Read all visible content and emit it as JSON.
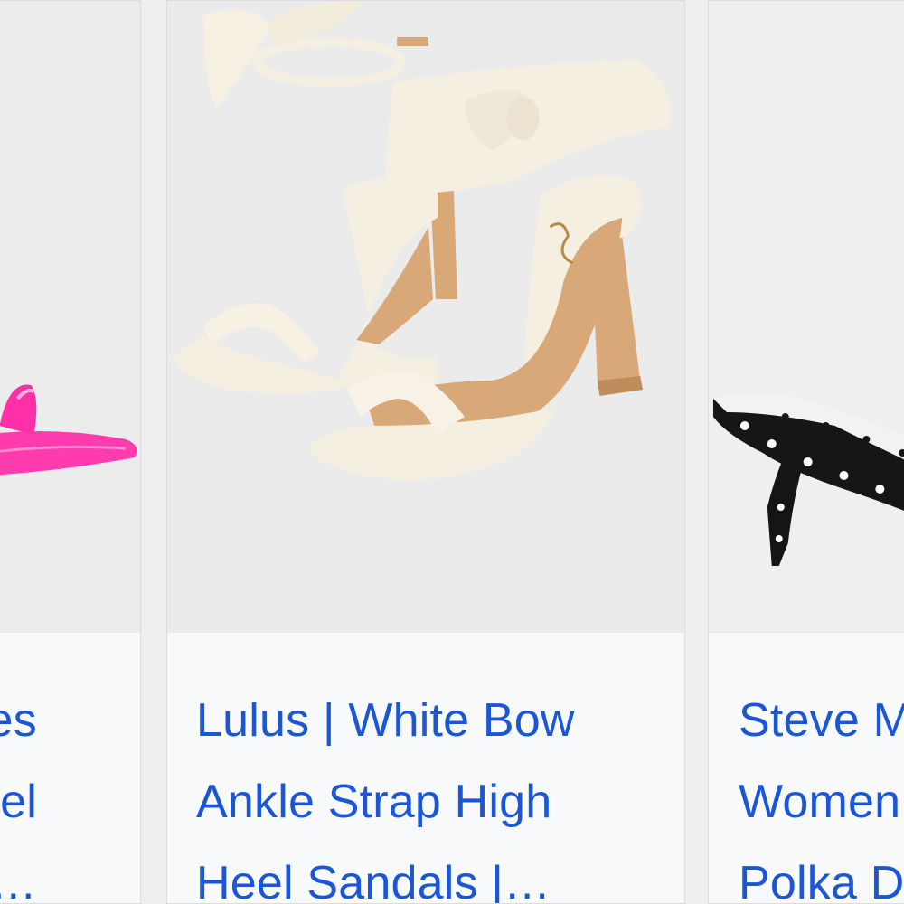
{
  "results": [
    {
      "title_lines": [
        "es",
        "el",
        "Pin…"
      ],
      "product": "pink satin heel sandal",
      "colors": {
        "shoe": "#ff2fa8",
        "background": "#ececec"
      }
    },
    {
      "title_lines": [
        "Lulus | White Bow",
        "Ankle Strap High",
        "Heel Sandals |…"
      ],
      "product": "white bow ankle strap high heel sandals",
      "colors": {
        "shoe": "#f4efe0",
        "lining": "#d9a878",
        "background": "#ebebeb"
      }
    },
    {
      "title_lines": [
        "Steve M",
        "Women",
        "Polka D"
      ],
      "product": "black polka dot kitten heel mule",
      "colors": {
        "shoe": "#161616",
        "dots": "#ffffff",
        "background": "#efefef"
      }
    }
  ],
  "theme": {
    "link_color": "#1a56d6",
    "caption_bg": "#f8f9fa",
    "border": "#dadce0"
  }
}
